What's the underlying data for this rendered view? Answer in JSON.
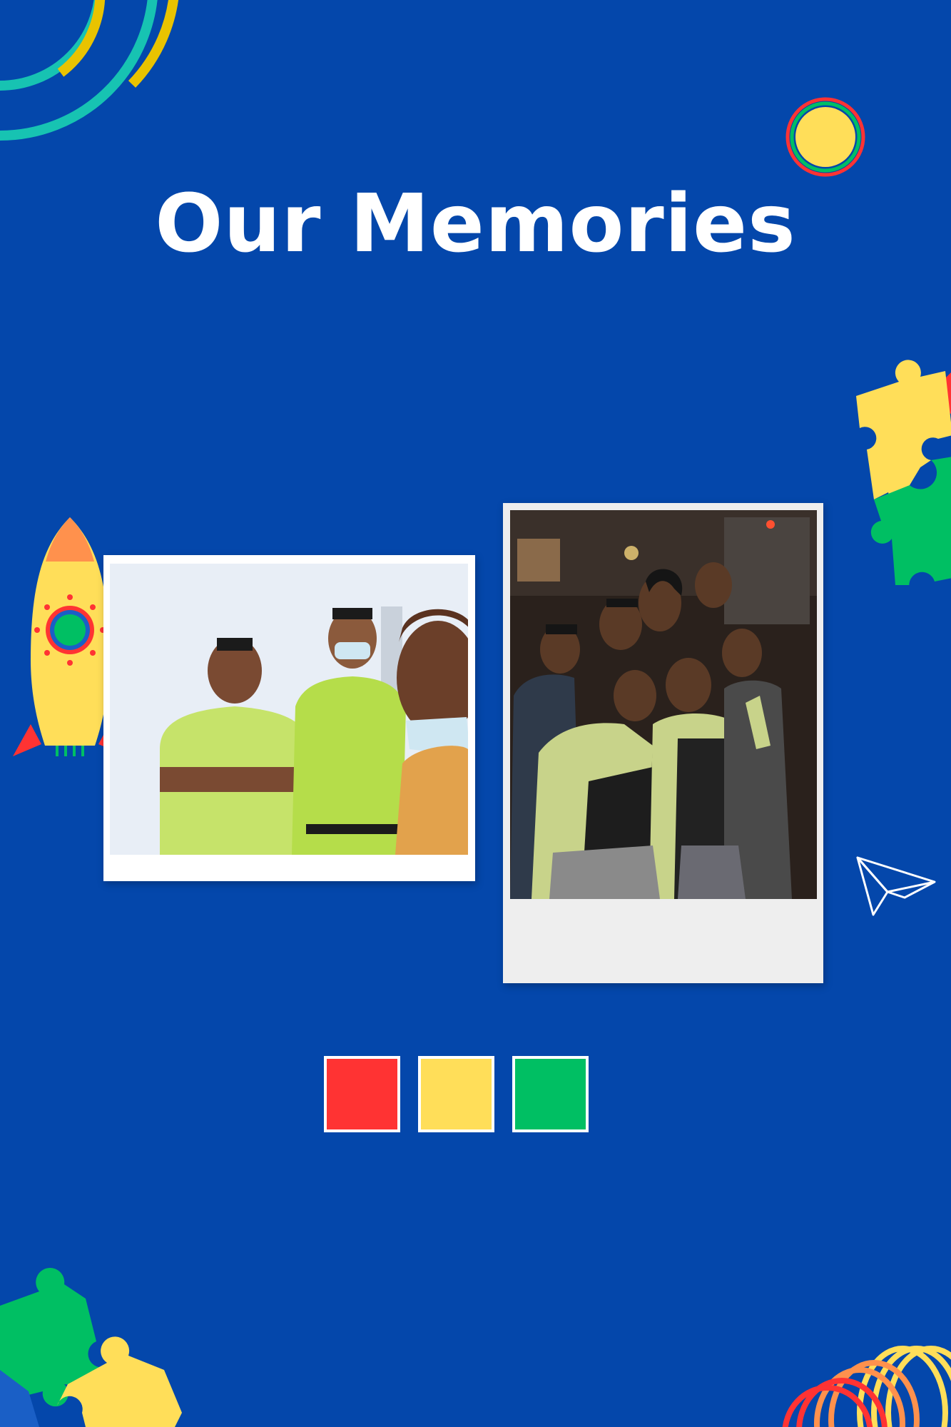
{
  "title": "Our Memories",
  "colors": {
    "background": "#0447ab",
    "red": "#ff3333",
    "yellow": "#ffde59",
    "green": "#00bf63",
    "teal": "#17c3b2",
    "orange": "#ff914d"
  },
  "swatches": [
    {
      "name": "red-swatch",
      "color": "#ff3333"
    },
    {
      "name": "yellow-swatch",
      "color": "#ffde59"
    },
    {
      "name": "green-swatch",
      "color": "#00bf63"
    }
  ],
  "icons": [
    "rocket-icon",
    "paper-plane-icon",
    "puzzle-pieces-icon",
    "arc-rings-icon",
    "planet-dot-icon",
    "spring-coil-icon"
  ],
  "photos": [
    {
      "name": "daytime-selfie-photo",
      "description_hidden": true
    },
    {
      "name": "night-group-photo",
      "description_hidden": true
    }
  ]
}
